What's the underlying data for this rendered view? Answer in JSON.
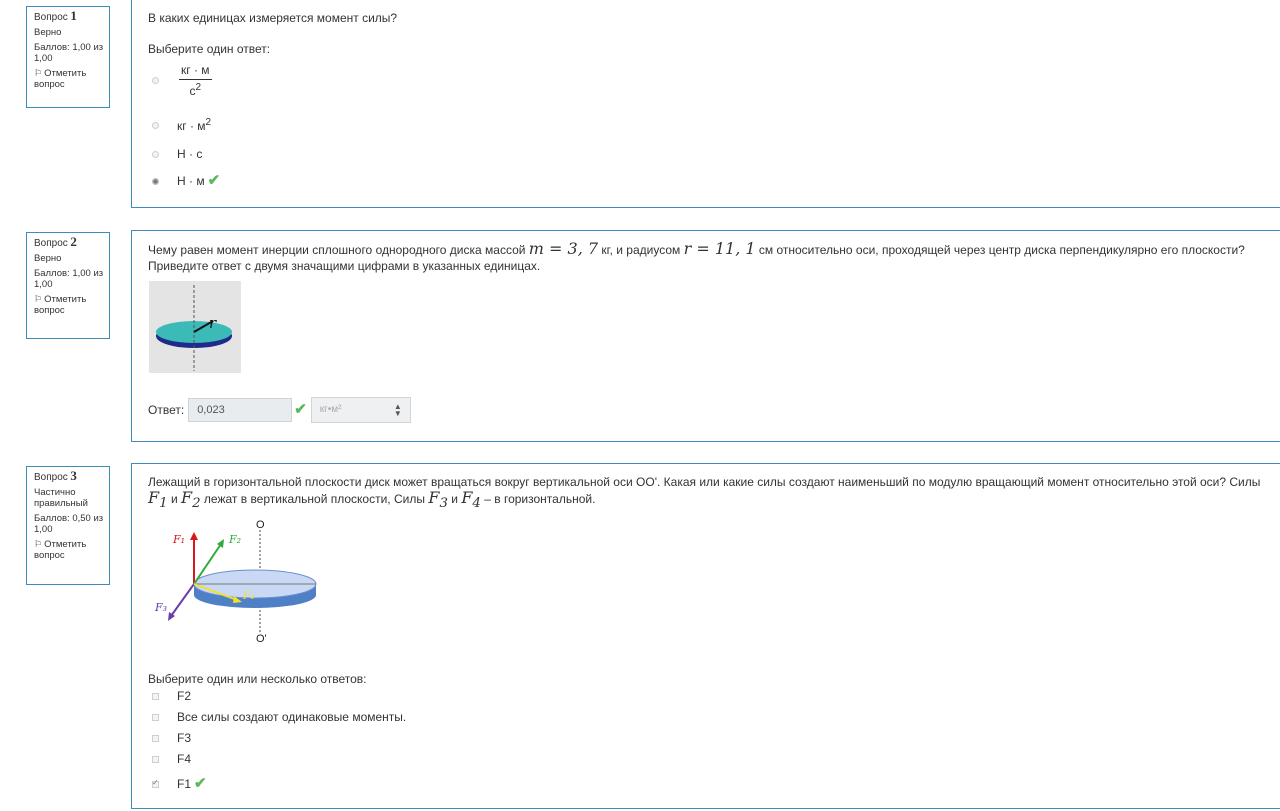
{
  "questions": [
    {
      "label": "Вопрос",
      "number": "1",
      "state": "Верно",
      "grade": "Баллов: 1,00 из 1,00",
      "flag": "Отметить вопрос",
      "text": "В каких единицах измеряется момент силы?",
      "prompt": "Выберите один ответ:",
      "options": [
        {
          "numerator": "кг · м",
          "denominator": "с",
          "exponent": "2",
          "checked": false
        },
        {
          "label": "кг · м",
          "exponent": "2",
          "checked": false
        },
        {
          "label": "Н · с",
          "checked": false
        },
        {
          "label": "Н · м",
          "checked": true,
          "correct": true
        }
      ]
    },
    {
      "label": "Вопрос",
      "number": "2",
      "state": "Верно",
      "grade": "Баллов: 1,00 из 1,00",
      "flag": "Отметить вопрос",
      "text_part1": "Чему равен момент инерции сплошного однородного диска массой",
      "mass_math": "m = 3, 7",
      "text_part2": "кг, и радиусом",
      "radius_math": "r = 11, 1",
      "text_part3": "см относительно оси, проходящей через центр диска перпендикулярно его плоскости? Приведите ответ с двумя значащими цифрами в указанных единицах.",
      "figure_label": "r",
      "answer_label": "Ответ:",
      "answer_value": "0,023",
      "unit_selected": "кг•м²"
    },
    {
      "label": "Вопрос",
      "number": "3",
      "state": "Частично правильный",
      "grade": "Баллов: 0,50 из 1,00",
      "flag": "Отметить вопрос",
      "text_part1": "Лежащий в горизонтальной плоскости диск может вращаться вокруг вертикальной оси OO'. Какая или какие силы создают наименьший по модулю вращающий момент относительно этой оси? Силы",
      "f1": "F",
      "f1_sub": "1",
      "and1": "и",
      "f2": "F",
      "f2_sub": "2",
      "text_part2": "лежат в вертикальной плоскости, Силы",
      "f3": "F",
      "f3_sub": "3",
      "and2": "и",
      "f4": "F",
      "f4_sub": "4",
      "text_part3": "– в горизонтальной.",
      "figure": {
        "axis_top": "O",
        "axis_bottom": "O'",
        "labels": [
          "F₁",
          "F₂",
          "F₃",
          "F₄"
        ]
      },
      "prompt": "Выберите один или несколько ответов:",
      "options": [
        {
          "label": "F2",
          "checked": false
        },
        {
          "label": "Все силы создают одинаковые моменты.",
          "checked": false
        },
        {
          "label": "F3",
          "checked": false
        },
        {
          "label": "F4",
          "checked": false
        },
        {
          "label": "F1",
          "checked": true,
          "correct": true
        }
      ]
    }
  ],
  "colors": {
    "border": "#3c8dbc",
    "correct": "#5cb85c"
  },
  "icons": {
    "flag": "flag-icon",
    "correct": "check-icon"
  }
}
